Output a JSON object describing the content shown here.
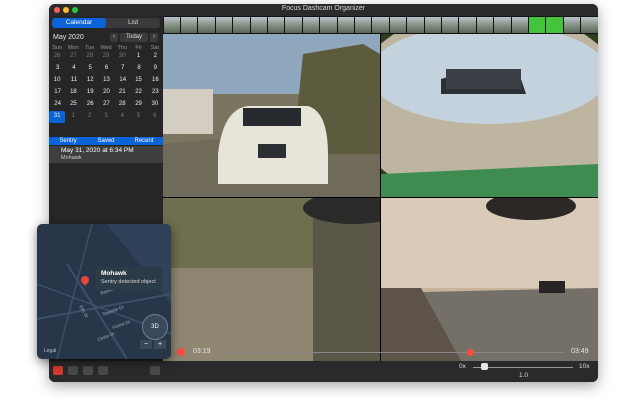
{
  "window": {
    "title": "Focus Dashcam Organizer"
  },
  "sidebar": {
    "tabs": [
      {
        "label": "Calendar",
        "active": true
      },
      {
        "label": "List",
        "active": false
      }
    ],
    "month_label": "May 2020",
    "today_label": "Today",
    "prev_icon": "chevron-left-icon",
    "next_icon": "chevron-right-icon",
    "weekdays": [
      "Sun",
      "Mon",
      "Tue",
      "Wed",
      "Thu",
      "Fri",
      "Sat"
    ],
    "weeks": [
      [
        "26",
        "27",
        "28",
        "29",
        "30",
        "1",
        "2"
      ],
      [
        "3",
        "4",
        "5",
        "6",
        "7",
        "8",
        "9"
      ],
      [
        "10",
        "11",
        "12",
        "13",
        "14",
        "15",
        "16"
      ],
      [
        "17",
        "18",
        "19",
        "20",
        "21",
        "22",
        "23"
      ],
      [
        "24",
        "25",
        "26",
        "27",
        "28",
        "29",
        "30"
      ],
      [
        "31",
        "1",
        "2",
        "3",
        "4",
        "5",
        "6"
      ]
    ],
    "selected_day": "31",
    "subtabs": [
      "Sentry",
      "Saved",
      "Recent"
    ],
    "event": {
      "datetime": "May 31, 2020 at 6:34 PM",
      "location": "Mohawk"
    }
  },
  "player": {
    "start_time": "03:19",
    "end_time": "03:49"
  },
  "map": {
    "popup_title": "Mohawk",
    "popup_subtitle": "Sentry detected object",
    "legal_label": "Legal",
    "btn_3d": "3D",
    "zoom_out": "−",
    "zoom_in": "+",
    "streets": [
      "Bayside Dr",
      "Elm Dr",
      "Seaside Dr",
      "Forest Dr",
      "Cedar Dr"
    ]
  },
  "bottom": {
    "speed_min": "0x",
    "speed_max": "10x",
    "speed_value": "1.0",
    "icons": [
      "heart-icon",
      "export-icon",
      "screen-icon",
      "location-icon",
      "grid-icon"
    ]
  },
  "colors": {
    "accent": "#0a64d8",
    "event_dot": "#ff4a3d"
  }
}
